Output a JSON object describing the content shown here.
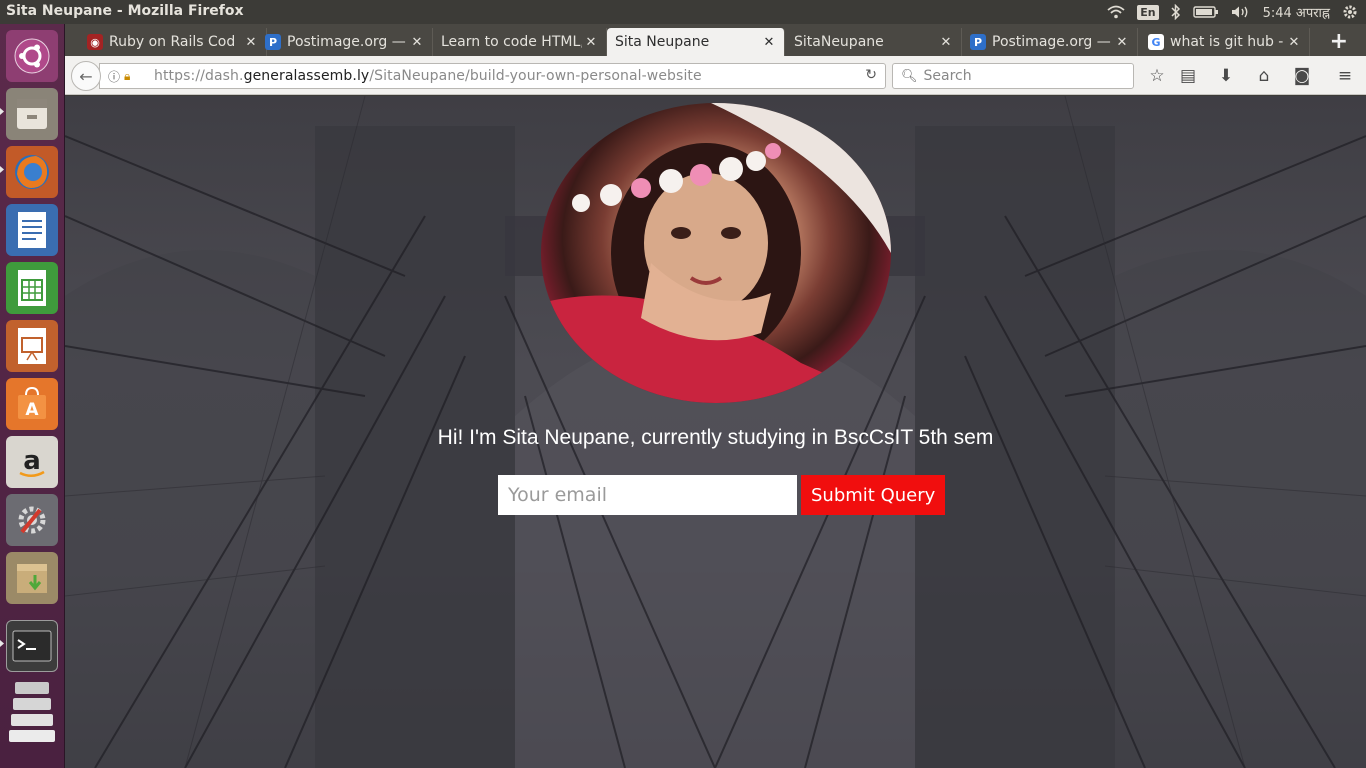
{
  "window": {
    "title": "Sita Neupane - Mozilla Firefox"
  },
  "system": {
    "language": "En",
    "time": "5:44 अपराह्न"
  },
  "launcher": {
    "items": [
      {
        "name": "ubuntu-dash-icon"
      },
      {
        "name": "files-icon"
      },
      {
        "name": "firefox-icon"
      },
      {
        "name": "writer-icon"
      },
      {
        "name": "calc-icon"
      },
      {
        "name": "impress-icon"
      },
      {
        "name": "software-center-icon"
      },
      {
        "name": "amazon-icon"
      },
      {
        "name": "system-settings-icon"
      },
      {
        "name": "archive-manager-icon"
      },
      {
        "name": "terminal-icon"
      },
      {
        "name": "workspaces-icon"
      }
    ]
  },
  "tabs": [
    {
      "label": "Ruby on Rails Cod",
      "favicon": "rails",
      "active": false
    },
    {
      "label": "Postimage.org —",
      "favicon": "P",
      "active": false
    },
    {
      "label": "Learn to code HTML,",
      "favicon": "",
      "active": false
    },
    {
      "label": "Sita Neupane",
      "favicon": "",
      "active": true
    },
    {
      "label": "SitaNeupane",
      "favicon": "",
      "active": false
    },
    {
      "label": "Postimage.org —",
      "favicon": "P",
      "active": false
    },
    {
      "label": "what is git hub - G",
      "favicon": "G",
      "active": false
    }
  ],
  "toolbar": {
    "url_prefix": "https://dash.",
    "url_host": "generalassemb.ly",
    "url_path": "/SitaNeupane/build-your-own-personal-website",
    "search_placeholder": "Search"
  },
  "page": {
    "greeting": "Hi! I'm Sita Neupane, currently studying in BscCsIT 5th sem",
    "email_placeholder": "Your email",
    "submit_label": "Submit Query"
  },
  "colors": {
    "submit_bg": "#f10e0e",
    "page_bg": "#47464c"
  }
}
